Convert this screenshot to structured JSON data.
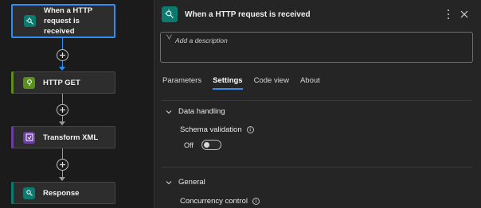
{
  "flow": {
    "nodes": [
      {
        "id": "trigger",
        "label": "When a HTTP request is received",
        "icon": "http-request-icon",
        "color": "#0b7a6f",
        "selected": true
      },
      {
        "id": "http-get",
        "label": "HTTP GET",
        "icon": "http-icon",
        "color": "#5a8f1e"
      },
      {
        "id": "transform-xml",
        "label": "Transform XML",
        "icon": "transform-icon",
        "color": "#6b3fa0"
      },
      {
        "id": "response",
        "label": "Response",
        "icon": "response-icon",
        "color": "#0b7a6f"
      }
    ],
    "add_step_icon": "plus-icon"
  },
  "panel": {
    "title": "When a HTTP request is received",
    "header_icon": "http-request-icon",
    "description_placeholder": "Add a description",
    "tabs": [
      {
        "label": "Parameters",
        "active": false
      },
      {
        "label": "Settings",
        "active": true
      },
      {
        "label": "Code view",
        "active": false
      },
      {
        "label": "About",
        "active": false
      }
    ],
    "sections": {
      "data_handling": {
        "title": "Data handling",
        "schema_validation_label": "Schema validation",
        "toggle_state": "Off"
      },
      "general": {
        "title": "General",
        "concurrency_label": "Concurrency control"
      }
    }
  },
  "colors": {
    "accent": "#2f8ef3",
    "trigger": "#0b7a6f",
    "http": "#5a8f1e",
    "transform": "#6b3fa0"
  }
}
